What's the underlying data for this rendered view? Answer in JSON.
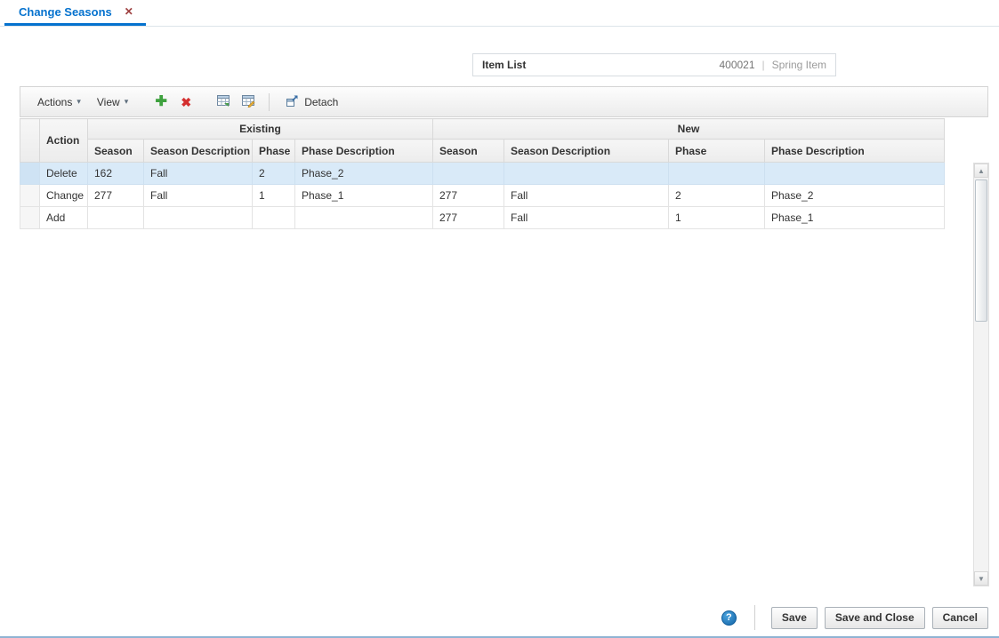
{
  "tab": {
    "label": "Change Seasons",
    "close_glyph": "✕"
  },
  "item_header": {
    "label": "Item List",
    "number": "400021",
    "separator": "|",
    "description": "Spring Item"
  },
  "toolbar": {
    "actions_label": "Actions",
    "view_label": "View",
    "detach_label": "Detach"
  },
  "icons": {
    "dropdown_caret": "▾",
    "add": "✚",
    "delete": "✖",
    "help": "?",
    "scroll_up": "▲",
    "scroll_down": "▼",
    "spreadsheet_export": "export-to-excel-icon",
    "spreadsheet_import": "import-from-excel-icon",
    "detach": "detach-icon"
  },
  "table": {
    "groups": {
      "existing": "Existing",
      "new": "New"
    },
    "columns": [
      "Action",
      "Season",
      "Season Description",
      "Phase",
      "Phase Description",
      "Season",
      "Season Description",
      "Phase",
      "Phase Description"
    ],
    "rows": [
      {
        "selected": true,
        "cells": [
          "Delete",
          "162",
          "Fall",
          "2",
          "Phase_2",
          "",
          "",
          "",
          ""
        ]
      },
      {
        "selected": false,
        "cells": [
          "Change",
          "277",
          "Fall",
          "1",
          "Phase_1",
          "277",
          "Fall",
          "2",
          "Phase_2"
        ]
      },
      {
        "selected": false,
        "cells": [
          "Add",
          "",
          "",
          "",
          "",
          "277",
          "Fall",
          "1",
          "Phase_1"
        ]
      }
    ]
  },
  "footer": {
    "help_glyph": "?",
    "save_label": "Save",
    "save_and_close_label": "Save and Close",
    "cancel_label": "Cancel"
  },
  "colors": {
    "accent_blue": "#0572ce",
    "selected_row": "#d9eaf8",
    "add_green": "#3ea13e",
    "delete_red": "#d42f2f"
  }
}
